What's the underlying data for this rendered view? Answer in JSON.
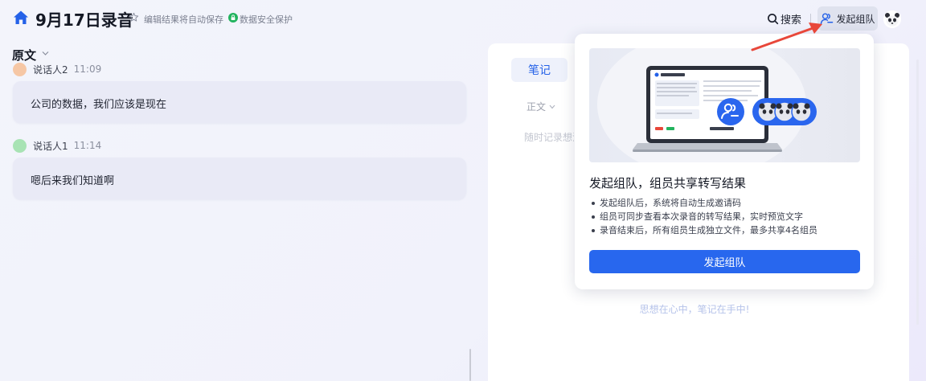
{
  "header": {
    "title": "9月17日录音",
    "autosave_note": "编辑结果将自动保存",
    "security_note": "数据安全保护",
    "search_label": "搜索",
    "team_button_label": "发起组队"
  },
  "transcript": {
    "section_title": "原文",
    "entries": [
      {
        "speaker": "说话人2",
        "time": "11:09",
        "text": "公司的数据，我们应该是现在"
      },
      {
        "speaker": "说话人1",
        "time": "11:14",
        "text": "嗯后来我们知道啊"
      }
    ]
  },
  "notes": {
    "tab_label": "笔记",
    "style_label": "正文",
    "placeholder": "随时记录想法",
    "slogan": "思想在心中，笔记在手中!"
  },
  "team_popover": {
    "title": "发起组队，组员共享转写结果",
    "bullets": [
      "发起组队后，系统将自动生成邀请码",
      "组员可同步查看本次录音的转写结果，实时预览文字",
      "录音结束后，所有组员生成独立文件，最多共享4名组员"
    ],
    "button_label": "发起组队"
  },
  "colors": {
    "accent": "#2867ee",
    "speaker2_avatar": "#f6c7a5",
    "speaker1_avatar": "#a8e3b4",
    "security_green": "#22b35e",
    "annotation_arrow": "#e8473a"
  }
}
